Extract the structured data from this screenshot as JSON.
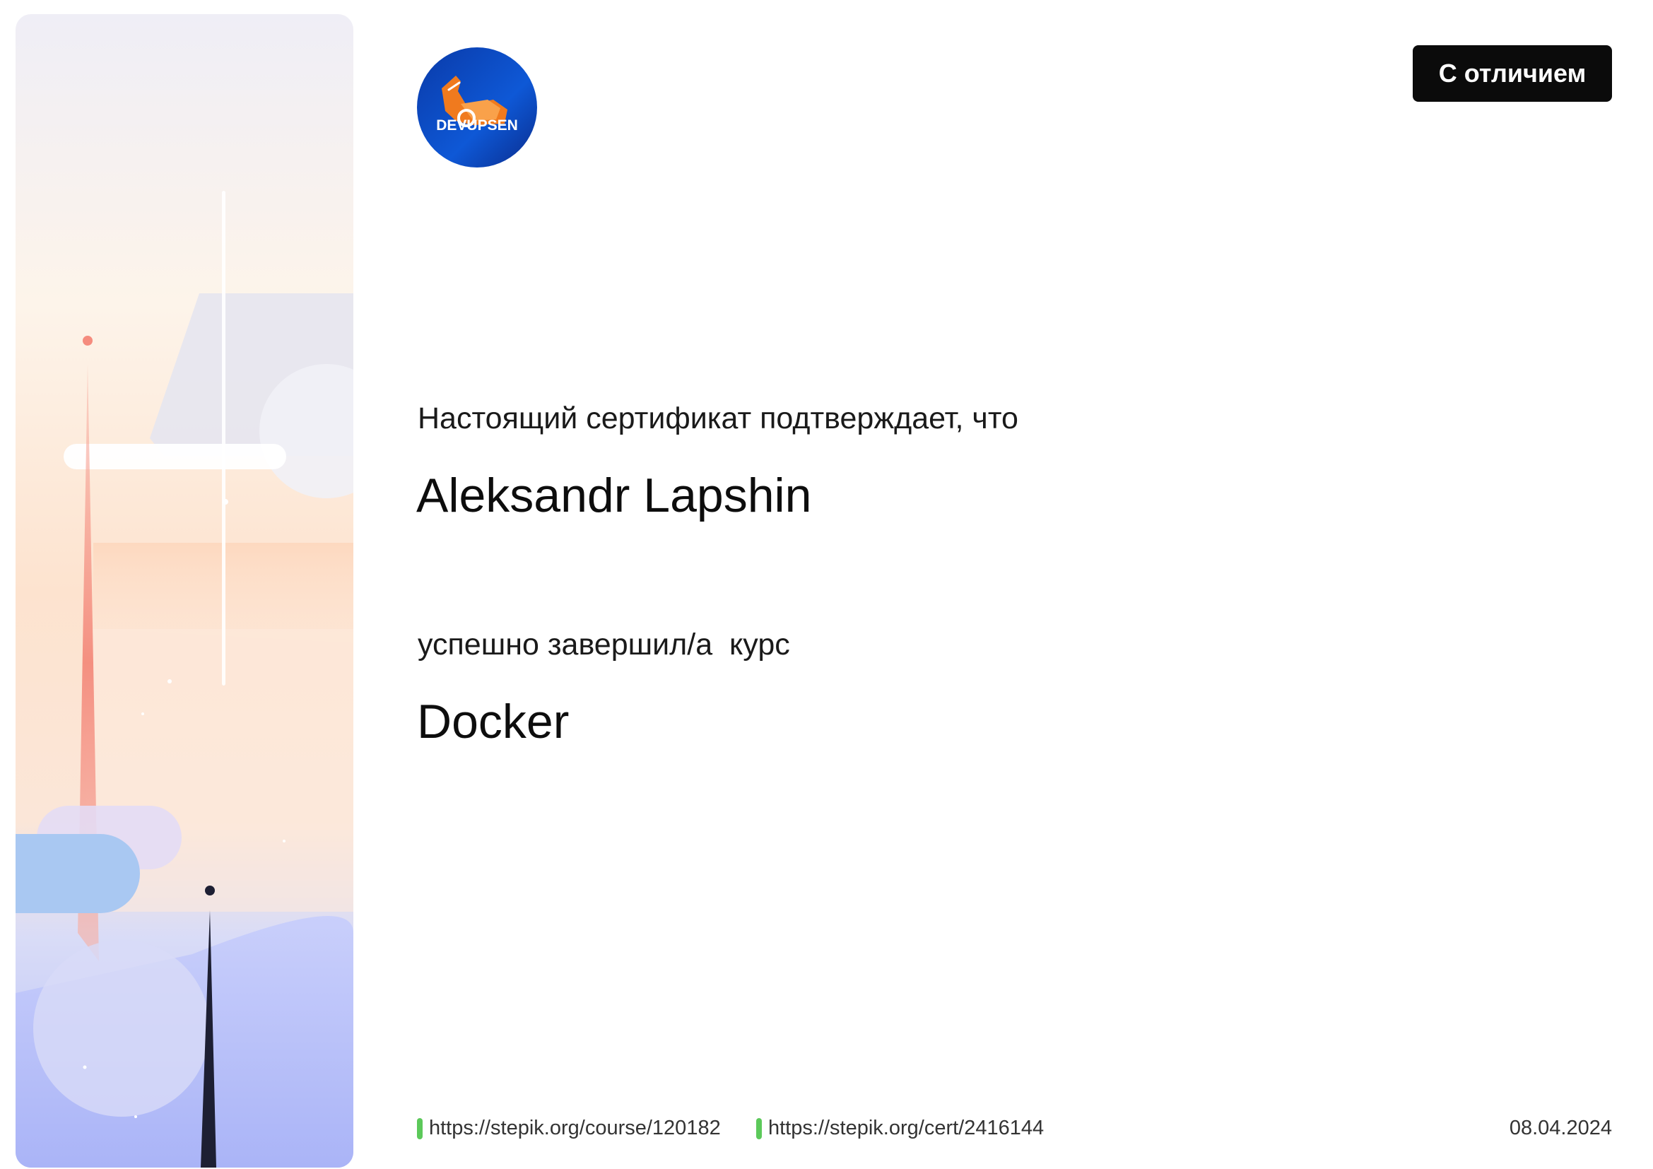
{
  "certificate": {
    "distinction_badge": "С отличием",
    "statement": "Настоящий сертификат подтверждает, что",
    "recipient_name": "Aleksandr Lapshin",
    "completion_text": "успешно завершил/а  курс",
    "course_name": "Docker",
    "course_link": "https://stepik.org/course/120182",
    "certificate_link": "https://stepik.org/cert/2416144",
    "issue_date": "08.04.2024"
  },
  "logo": {
    "text": "DEVUPSEN",
    "icon": "excavator-icon"
  },
  "colors": {
    "link_marker": "#5cc95a",
    "badge_background": "#0b0b0b",
    "logo_blue": "#1040c0",
    "logo_orange": "#f07a1e"
  }
}
